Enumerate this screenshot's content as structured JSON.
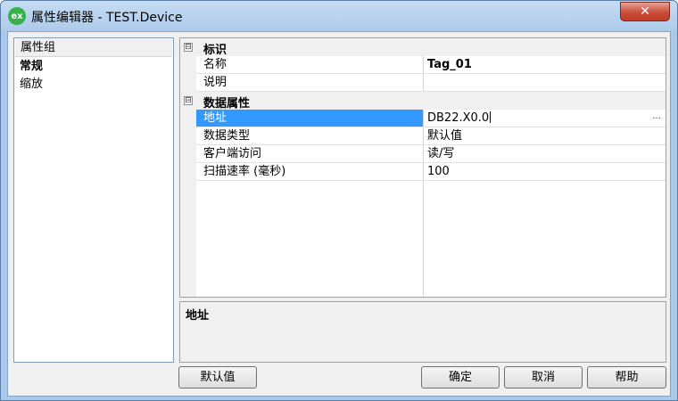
{
  "window": {
    "title": "属性编辑器 - TEST.Device",
    "app_icon_text": "ex",
    "close_glyph": "✕"
  },
  "groups": {
    "header": "属性组",
    "items": [
      "常规",
      "缩放"
    ]
  },
  "grid": {
    "categories": [
      {
        "label": "标识",
        "expander": "⊟"
      },
      {
        "label": "数据属性",
        "expander": "⊟"
      }
    ],
    "identity_rows": [
      {
        "name": "名称",
        "value": "Tag_01"
      },
      {
        "name": "说明",
        "value": ""
      }
    ],
    "data_rows": [
      {
        "name": "地址",
        "value": "DB22.X0.0",
        "button": "..."
      },
      {
        "name": "数据类型",
        "value": "默认值"
      },
      {
        "name": "客户端访问",
        "value": "读/写"
      },
      {
        "name": "扫描速率 (毫秒)",
        "value": "100"
      }
    ]
  },
  "description": {
    "title": "地址"
  },
  "buttons": {
    "default": "默认值",
    "ok": "确定",
    "cancel": "取消",
    "help": "帮助"
  },
  "colors": {
    "selection": "#3399ff",
    "title_bar": "#aecbeb",
    "close_button": "#c84e3a"
  }
}
